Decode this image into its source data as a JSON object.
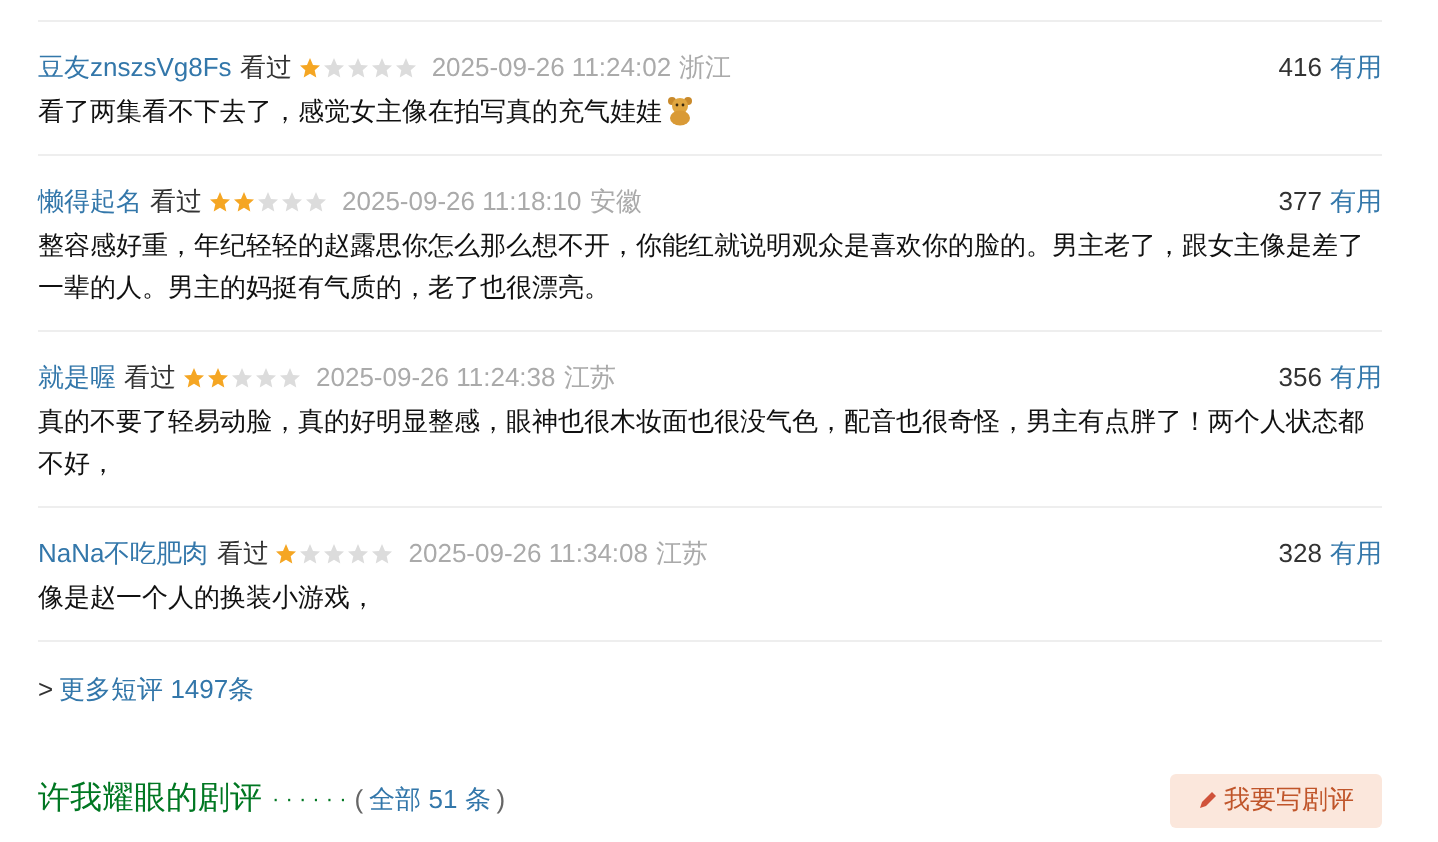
{
  "reviews": [
    {
      "user": "豆友znszsVg8Fs",
      "status": "看过",
      "stars": 1,
      "time": "2025-09-26 11:24:02",
      "location": "浙江",
      "votes": "416",
      "vote_label": "有用",
      "text": "看了两集看不下去了，感觉女主像在拍写真的充气娃娃",
      "emoji": true
    },
    {
      "user": "懒得起名",
      "status": "看过",
      "stars": 2,
      "time": "2025-09-26 11:18:10",
      "location": "安徽",
      "votes": "377",
      "vote_label": "有用",
      "text": "整容感好重，年纪轻轻的赵露思你怎么那么想不开，你能红就说明观众是喜欢你的脸的。男主老了，跟女主像是差了一辈的人。男主的妈挺有气质的，老了也很漂亮。",
      "emoji": false
    },
    {
      "user": "就是喔",
      "status": "看过",
      "stars": 2,
      "time": "2025-09-26 11:24:38",
      "location": "江苏",
      "votes": "356",
      "vote_label": "有用",
      "text": "真的不要了轻易动脸，真的好明显整感，眼神也很木妆面也很没气色，配音也很奇怪，男主有点胖了！两个人状态都不好，",
      "emoji": false
    },
    {
      "user": "NaNa不吃肥肉",
      "status": "看过",
      "stars": 1,
      "time": "2025-09-26 11:34:08",
      "location": "江苏",
      "votes": "328",
      "vote_label": "有用",
      "text": "像是赵一个人的换装小游戏，",
      "emoji": false
    }
  ],
  "more_link": {
    "arrow": ">",
    "label": "更多短评 1497条"
  },
  "section": {
    "title": "许我耀眼的剧评",
    "dots": "· · · · · ·",
    "count_open": "(",
    "count": "全部 51 条",
    "count_close": ")",
    "write_button": "我要写剧评"
  }
}
